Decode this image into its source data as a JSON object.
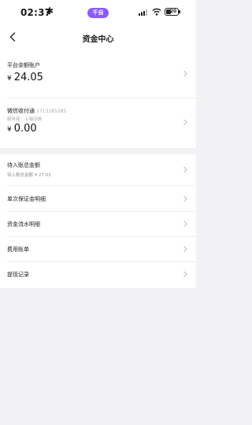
{
  "status_bar": {
    "time": "02:37",
    "extra_glyph": "✱",
    "pill_label": "千自",
    "battery_level": "20",
    "icons": [
      "signal-icon",
      "wifi-icon",
      "battery-icon"
    ]
  },
  "nav": {
    "back_icon": "chevron-left-icon",
    "title": "资金中心"
  },
  "accounts": [
    {
      "title": "平台余额账户",
      "currency": "¥",
      "amount": "24.05"
    },
    {
      "title": "微信收付通",
      "account_no": "1713165285",
      "note": "服务商：上海旧融",
      "currency": "¥",
      "amount": "0.00"
    }
  ],
  "list": [
    {
      "label": "待入账总金额",
      "sub": "待入账总金额 ¥ 27.03"
    },
    {
      "label": "单次保证金明细"
    },
    {
      "label": "资金流水明细"
    },
    {
      "label": "费用账单"
    },
    {
      "label": "提现记录"
    }
  ],
  "colors": {
    "background": "#f2f2f4",
    "card": "#ffffff",
    "accent_pill": "#8b5cf6",
    "muted_text": "#a8a8a8"
  }
}
